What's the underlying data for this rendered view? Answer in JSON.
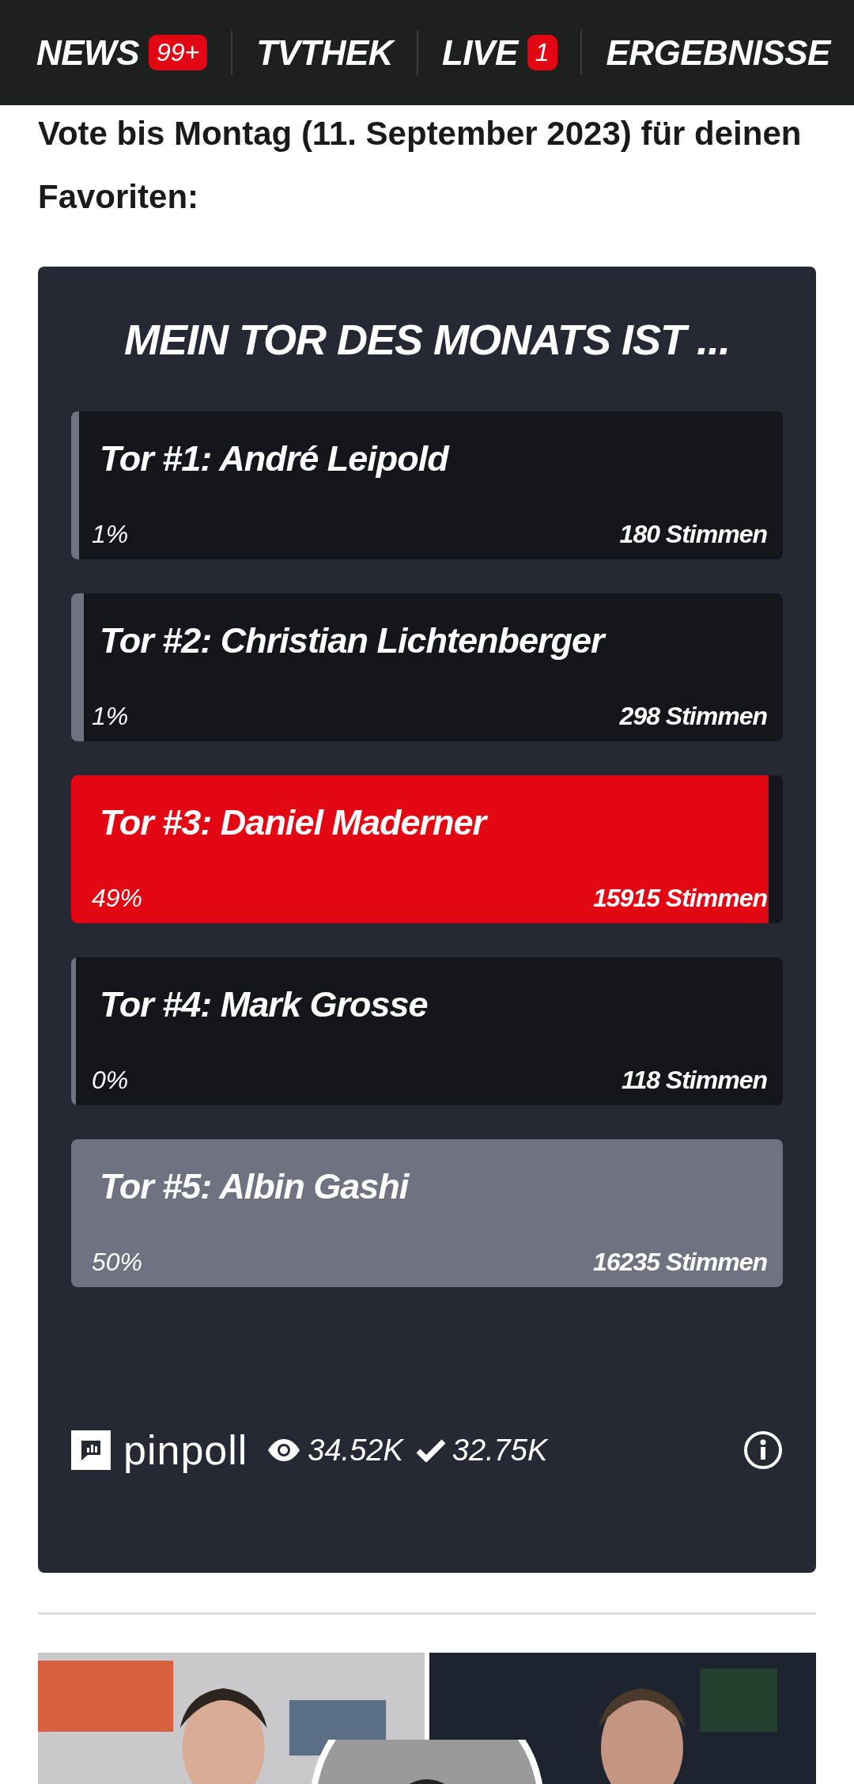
{
  "nav": [
    {
      "label": "NEWS",
      "badge": "99+"
    },
    {
      "label": "TVTHEK"
    },
    {
      "label": "LIVE",
      "badge": "1"
    },
    {
      "label": "ERGEBNISSE"
    }
  ],
  "intro": "Vote bis Montag (11. September 2023) für deinen Favoriten:",
  "poll": {
    "title": "MEIN TOR DES MONATS IST ...",
    "options": [
      {
        "label": "Tor #1: André Leipold",
        "percent": "1%",
        "votes": "180 Stimmen",
        "level": 0.011,
        "selected": false
      },
      {
        "label": "Tor #2: Christian Lichtenberger",
        "percent": "1%",
        "votes": "298 Stimmen",
        "level": 0.018,
        "selected": false
      },
      {
        "label": "Tor #3: Daniel Maderner",
        "percent": "49%",
        "votes": "15915 Stimmen",
        "level": 0.98,
        "selected": true
      },
      {
        "label": "Tor #4: Mark Grosse",
        "percent": "0%",
        "votes": "118 Stimmen",
        "level": 0.007,
        "selected": false
      },
      {
        "label": "Tor #5: Albin Gashi",
        "percent": "50%",
        "votes": "16235 Stimmen",
        "level": 1.0,
        "selected": false
      }
    ],
    "brand": "pinpoll",
    "views": "34.52K",
    "votes_total": "32.75K"
  }
}
